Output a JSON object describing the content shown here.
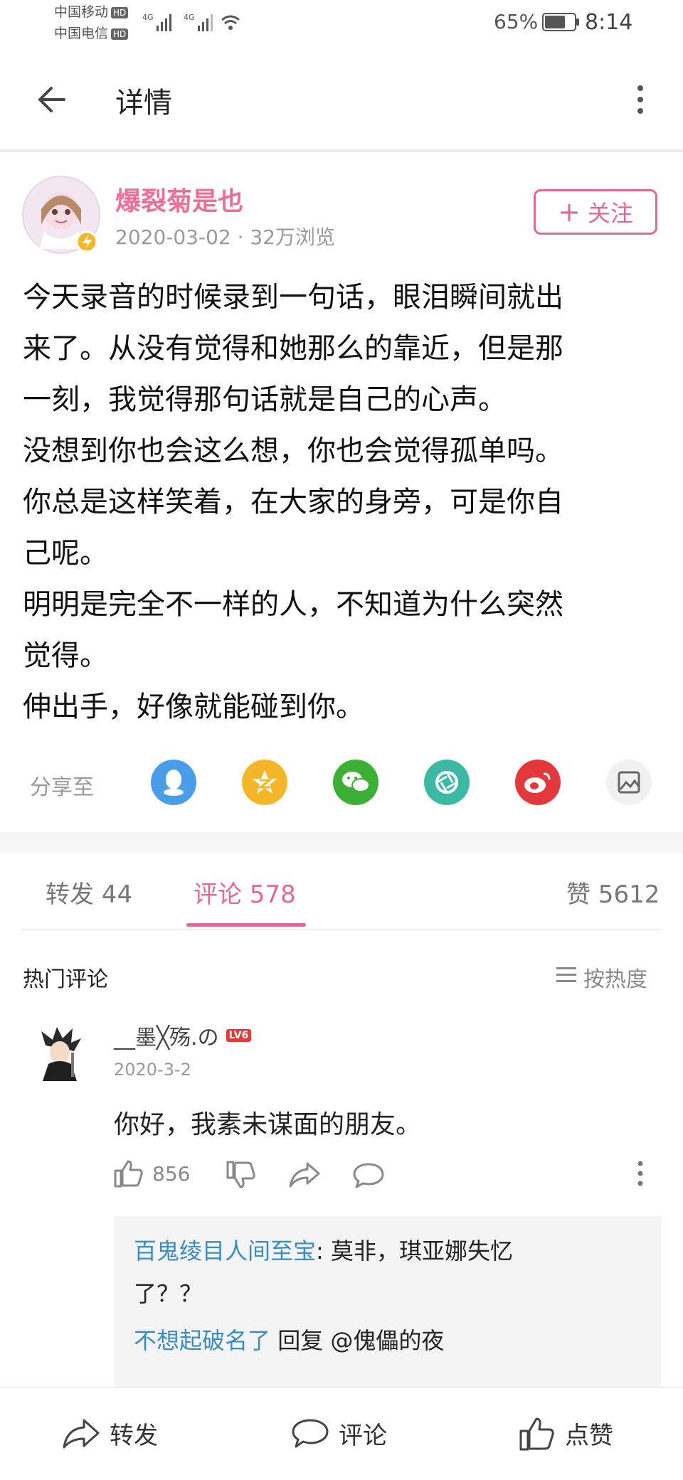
{
  "status": {
    "carrier1": "中国移动",
    "carrier2": "中国电信",
    "hd": "HD",
    "net": "4G",
    "battery": "65%",
    "time": "8:14"
  },
  "header": {
    "title": "详情"
  },
  "post": {
    "username": "爆裂菊是也",
    "meta": "2020-03-02 · 32万浏览",
    "follow_label": "关注",
    "paragraphs": [
      "今天录音的时候录到一句话，眼泪瞬间就出",
      "来了。从没有觉得和她那么的靠近，但是那",
      "一刻，我觉得那句话就是自己的心声。",
      "没想到你也会这么想，你也会觉得孤单吗。",
      "你总是这样笑着，在大家的身旁，可是你自",
      "己呢。",
      "明明是完全不一样的人，不知道为什么突然",
      "觉得。",
      "伸出手，好像就能碰到你。"
    ],
    "share_label": "分享至"
  },
  "tabs": {
    "repost": "转发 44",
    "comment": "评论 578",
    "like": "赞 5612"
  },
  "comments_section": {
    "title": "热门评论",
    "sort_label": "按热度"
  },
  "comment": {
    "user": "__墨╳殇.の",
    "level": "LV6",
    "date": "2020-3-2",
    "text": "你好，我素未谋面的朋友。",
    "likes": "856",
    "replies": [
      {
        "user": "百鬼绫目人间至宝",
        "text": ": 莫非，琪亚娜失忆",
        "text2": "了？？"
      },
      {
        "user": "不想起破名了",
        "text": " 回复 @傀儡的夜"
      }
    ]
  },
  "bottom_bar": {
    "repost": "转发",
    "comment": "评论",
    "like": "点赞"
  },
  "colors": {
    "accent": "#e06a95",
    "link": "#3a8cc4"
  }
}
